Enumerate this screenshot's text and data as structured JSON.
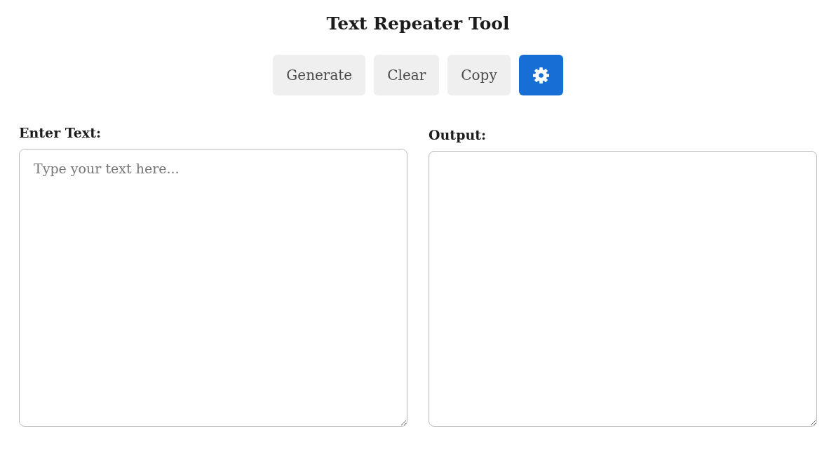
{
  "title": "Text Repeater Tool",
  "toolbar": {
    "buttons": [
      {
        "kind": "text",
        "label": "Generate"
      },
      {
        "kind": "text",
        "label": "Clear"
      },
      {
        "kind": "text",
        "label": "Copy"
      },
      {
        "kind": "settings"
      }
    ]
  },
  "panels": [
    {
      "kind": "input",
      "label": "Enter Text:",
      "placeholder": "Type your text here..."
    },
    {
      "kind": "output",
      "label": "Output:"
    }
  ]
}
